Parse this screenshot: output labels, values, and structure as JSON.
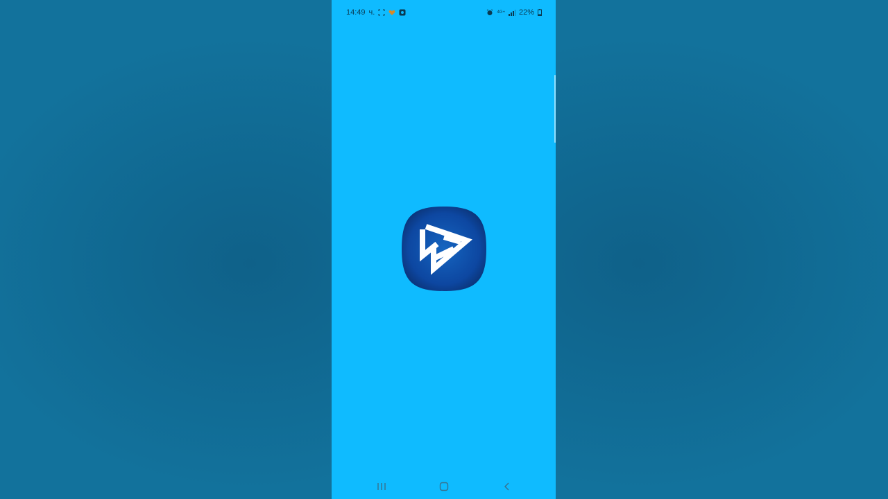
{
  "status_bar": {
    "time": "14:49",
    "day_suffix": "ч.",
    "battery_percent": "22%",
    "network_label": "4G+",
    "icons_left": [
      "screen-capture-icon",
      "heart-icon",
      "app-notification-icon"
    ],
    "icons_right": [
      "alarm-icon",
      "network-type-icon",
      "signal-icon",
      "battery-icon"
    ]
  },
  "app": {
    "icon": "play-triangles-logo-icon",
    "colors": {
      "screen_background": "#0fbbff",
      "icon_gradient_center": "#1565c0",
      "icon_gradient_edge": "#0a2f6e",
      "logo_foreground": "#ffffff"
    }
  },
  "nav_bar": {
    "buttons": [
      "recent-apps-icon",
      "home-icon",
      "back-icon"
    ]
  }
}
